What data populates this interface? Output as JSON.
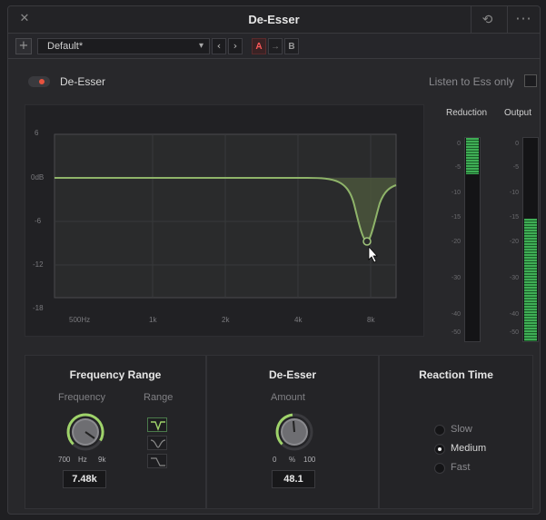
{
  "window": {
    "title": "De-Esser"
  },
  "preset": {
    "name": "Default*",
    "compare_a": "A",
    "compare_b": "B"
  },
  "plugin": {
    "enable_label": "De-Esser",
    "enabled": true,
    "listen_label": "Listen to Ess only"
  },
  "graph": {
    "y_ticks": [
      "6",
      "0dB",
      "-6",
      "-12",
      "-18"
    ],
    "x_ticks": [
      "500Hz",
      "1k",
      "2k",
      "4k",
      "8k"
    ]
  },
  "meters": {
    "reduction_label": "Reduction",
    "output_label": "Output",
    "ticks": [
      "0",
      "-5",
      "-10",
      "-15",
      "-20",
      "-30",
      "-40",
      "-50"
    ],
    "reduction_level_db": -6,
    "output_level_db": -15
  },
  "frequency_range": {
    "title": "Frequency Range",
    "frequency_label": "Frequency",
    "range_label": "Range",
    "scale_min": "700",
    "scale_unit": "Hz",
    "scale_max": "9k",
    "value": "7.48k"
  },
  "de_esser": {
    "title": "De-Esser",
    "amount_label": "Amount",
    "scale_min": "0",
    "scale_unit": "%",
    "scale_max": "100",
    "value": "48.1"
  },
  "reaction_time": {
    "title": "Reaction Time",
    "options": [
      "Slow",
      "Medium",
      "Fast"
    ],
    "selected": "Medium"
  },
  "colors": {
    "accent_green": "#6fa85a",
    "enable_red": "#e8533f",
    "meter_green": "#3fae55"
  }
}
